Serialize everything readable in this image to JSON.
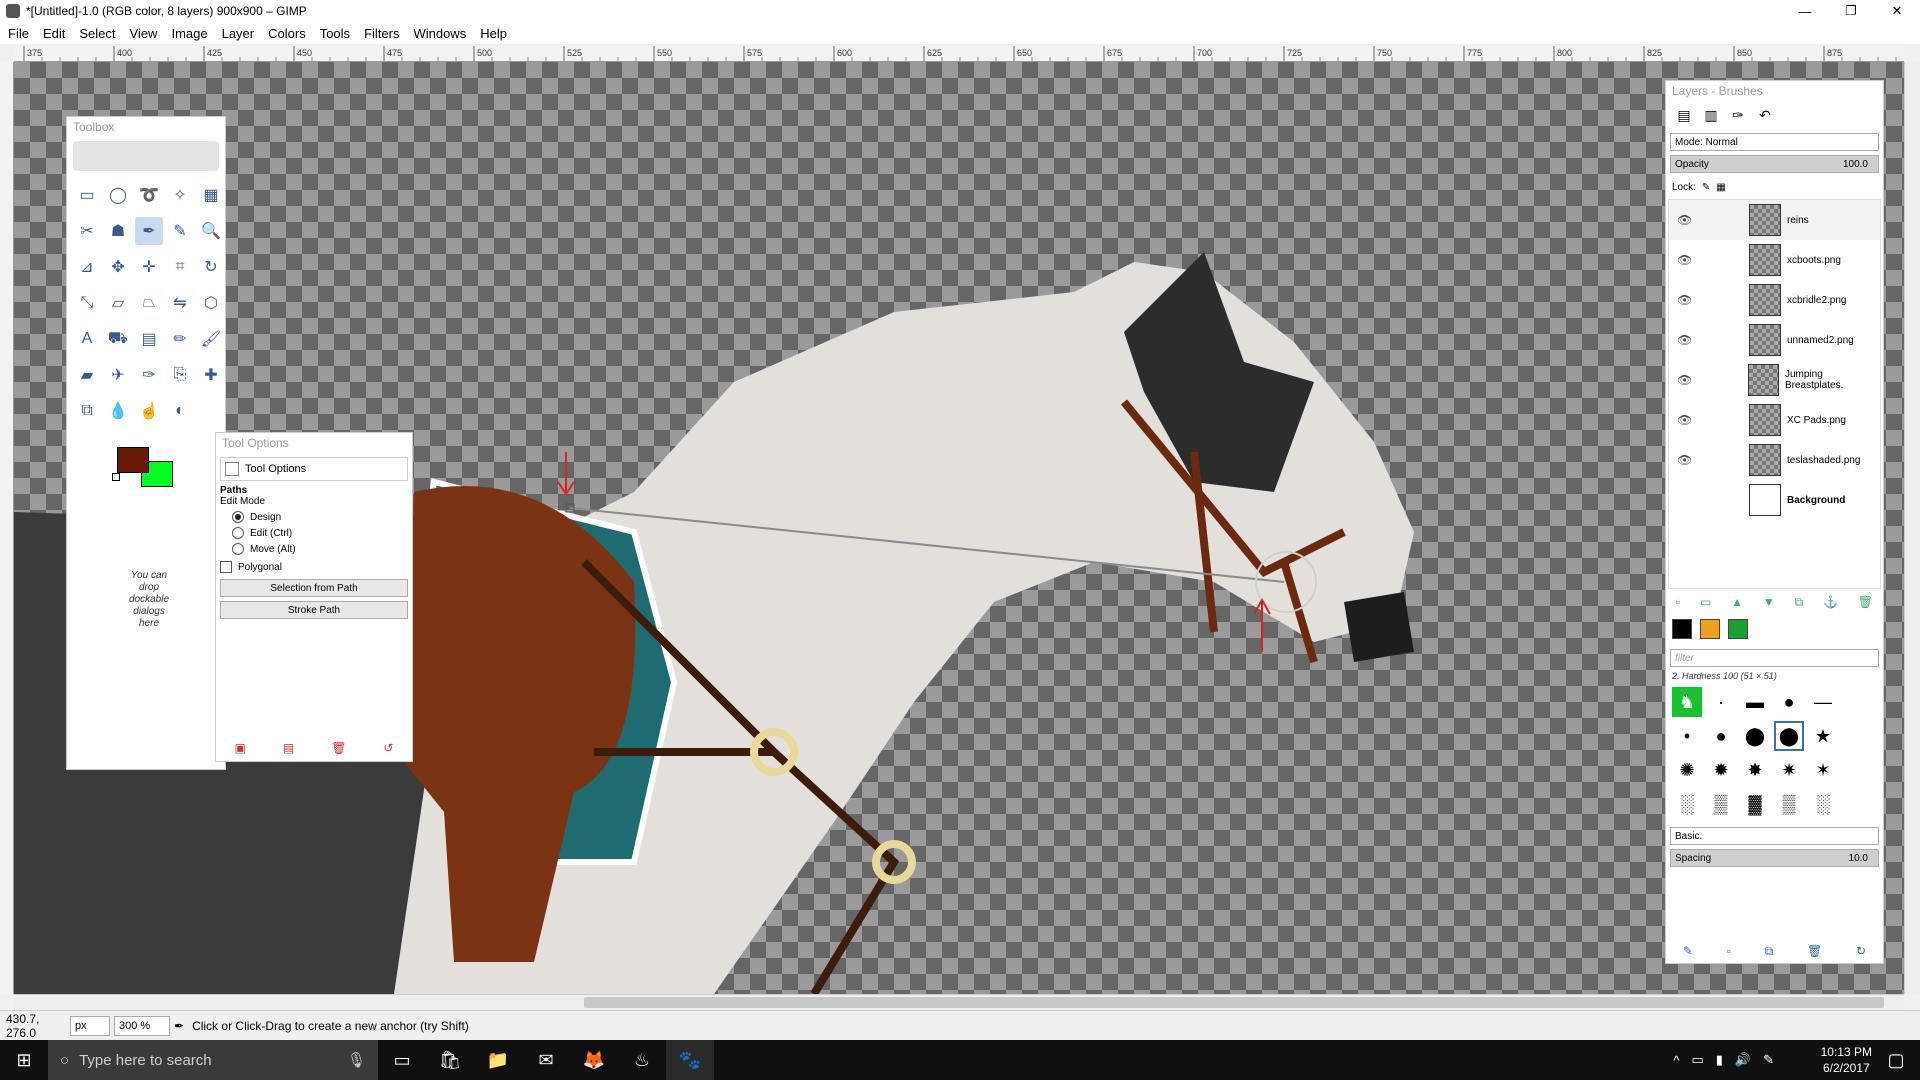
{
  "window": {
    "title": "*[Untitled]-1.0 (RGB color, 8 layers) 900x900 – GIMP",
    "controls": [
      "—",
      "❐",
      "✕"
    ]
  },
  "menu": [
    "File",
    "Edit",
    "Select",
    "View",
    "Image",
    "Layer",
    "Colors",
    "Tools",
    "Filters",
    "Windows",
    "Help"
  ],
  "ruler": {
    "ticks": [
      "375",
      "400",
      "425",
      "450",
      "475",
      "500",
      "525",
      "550",
      "575",
      "600",
      "625",
      "650",
      "675",
      "700",
      "725",
      "750",
      "775",
      "800",
      "825",
      "850",
      "875"
    ]
  },
  "toolbox": {
    "title": "Toolbox",
    "drop_hint": "You can drop dockable dialogs here",
    "foreground_color": "#6b1a08",
    "background_color": "#00ff20",
    "tools": [
      {
        "name": "rect-select-icon",
        "glyph": "▭"
      },
      {
        "name": "ellipse-select-icon",
        "glyph": "◯"
      },
      {
        "name": "free-select-icon",
        "glyph": "➰"
      },
      {
        "name": "fuzzy-select-icon",
        "glyph": "✧"
      },
      {
        "name": "select-by-color-icon",
        "glyph": "▦"
      },
      {
        "name": "scissors-icon",
        "glyph": "✂"
      },
      {
        "name": "foreground-select-icon",
        "glyph": "☗"
      },
      {
        "name": "paths-icon",
        "glyph": "✒"
      },
      {
        "name": "color-picker-icon",
        "glyph": "✎"
      },
      {
        "name": "zoom-icon",
        "glyph": "🔍"
      },
      {
        "name": "measure-icon",
        "glyph": "⊿"
      },
      {
        "name": "move-icon",
        "glyph": "✥"
      },
      {
        "name": "align-icon",
        "glyph": "✛"
      },
      {
        "name": "crop-icon",
        "glyph": "⌗"
      },
      {
        "name": "rotate-icon",
        "glyph": "↻"
      },
      {
        "name": "scale-icon",
        "glyph": "⤡"
      },
      {
        "name": "shear-icon",
        "glyph": "▱"
      },
      {
        "name": "perspective-icon",
        "glyph": "⏢"
      },
      {
        "name": "flip-icon",
        "glyph": "⇋"
      },
      {
        "name": "cage-icon",
        "glyph": "⬡"
      },
      {
        "name": "text-icon",
        "glyph": "A"
      },
      {
        "name": "bucket-fill-icon",
        "glyph": "⛟"
      },
      {
        "name": "blend-icon",
        "glyph": "▤"
      },
      {
        "name": "pencil-icon",
        "glyph": "✏"
      },
      {
        "name": "paintbrush-icon",
        "glyph": "🖌"
      },
      {
        "name": "eraser-icon",
        "glyph": "▰"
      },
      {
        "name": "airbrush-icon",
        "glyph": "✈"
      },
      {
        "name": "ink-icon",
        "glyph": "✑"
      },
      {
        "name": "clone-icon",
        "glyph": "⎘"
      },
      {
        "name": "heal-icon",
        "glyph": "✚"
      },
      {
        "name": "perspective-clone-icon",
        "glyph": "⧉"
      },
      {
        "name": "blur-icon",
        "glyph": "💧"
      },
      {
        "name": "smudge-icon",
        "glyph": "☝"
      },
      {
        "name": "dodge-burn-icon",
        "glyph": "◐"
      }
    ]
  },
  "tool_options": {
    "title": "Tool Options",
    "tab_label": "Tool Options",
    "section": "Paths",
    "edit_mode_label": "Edit Mode",
    "modes": [
      "Design",
      "Edit (Ctrl)",
      "Move (Alt)"
    ],
    "selected_mode": "Design",
    "polygonal_label": "Polygonal",
    "selection_button": "Selection from Path",
    "stroke_button": "Stroke Path"
  },
  "layers_panel": {
    "title": "Layers - Brushes",
    "mode_label": "Mode: Normal",
    "opacity_label": "Opacity",
    "opacity_value": "100.0",
    "lock_label": "Lock:",
    "layers": [
      {
        "name": "reins",
        "selected": true
      },
      {
        "name": "xcboots.png"
      },
      {
        "name": "xcbridle2.png"
      },
      {
        "name": "unnamed2.png"
      },
      {
        "name": "Jumping Breastplates."
      },
      {
        "name": "XC Pads.png"
      },
      {
        "name": "teslashaded.png"
      },
      {
        "name": "Background",
        "white": true
      }
    ]
  },
  "brushes": {
    "filter_placeholder": "filter",
    "current_brush": "2. Hardness 100 (51 × 51)",
    "preset": "Basic.",
    "spacing_label": "Spacing",
    "spacing_value": "10.0"
  },
  "status": {
    "coords": "430.7, 276.0",
    "unit": "px",
    "zoom": "300 %",
    "message": "Click or Click-Drag to create a new anchor (try Shift)"
  },
  "taskbar": {
    "search_placeholder": "Type here to search",
    "time": "10:13 PM",
    "date": "6/2/2017"
  }
}
